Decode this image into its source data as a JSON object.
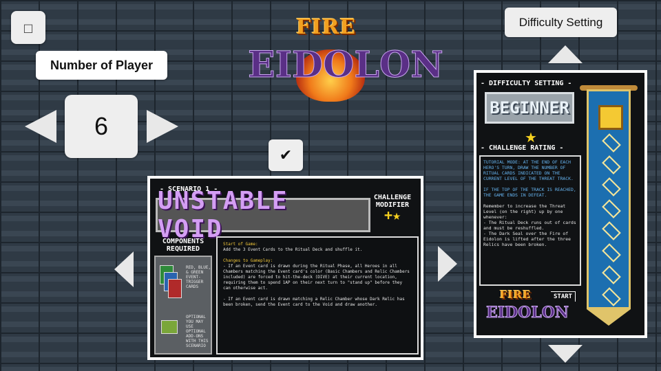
{
  "controls": {
    "menu_glyph": "□",
    "player_label": "Number of Player",
    "player_count": "6",
    "confirm_glyph": "✔",
    "difficulty_button": "Difficulty Setting"
  },
  "logo": {
    "line1": "FIRE",
    "line2": "EIDOLON"
  },
  "scenario": {
    "number_label": "- SCENARIO 1 -",
    "title": "UNSTABLE VOID",
    "challenge_modifier": "CHALLENGE MODIFIER",
    "modifier_value": "+★",
    "components_label": "COMPONENTS REQUIRED",
    "component1": "RED, BLUE, & GREEN EVENT-TRIGGER CARDS",
    "component2": "OPTIONAL YOU MAY USE OPTIONAL ADD-ONS WITH THIS SCENARIO",
    "start_heading": "Start of Game:",
    "start_text": "Add the 3 Event Cards to the Ritual Deck and shuffle it.",
    "changes_heading": "Changes to Gameplay:",
    "rule1": "- If an Event card is drawn during the Ritual Phase, all Heroes in all Chambers matching the Event card's color (Basic Chambers and Relic Chambers included) are forced to hit-the-deck (DIVE) at their current location, requiring them to spend 1AP on their next turn to \"stand up\" before they can otherwise act.",
    "rule2": "- If an Event card is drawn matching a Relic Chamber whose Dark Relic has been broken, send the Event card to the Void and draw another."
  },
  "difficulty": {
    "heading": "- DIFFICULTY SETTING -",
    "level": "BEGINNER",
    "star": "★",
    "rating_heading": "- CHALLENGE RATING -",
    "tutorial": "TUTORIAL MODE: AT THE END OF EACH HERO'S TURN, DRAW THE NUMBER OF RITUAL CARDS INDICATED ON THE CURRENT LEVEL OF THE THREAT TRACK.",
    "defeat": "IF THE TOP OF THE TRACK IS REACHED, THE GAME ENDS IN DEFEAT.",
    "remember": "Remember to increase the Threat Level (on the right) up by one whenever:",
    "cond1": "- The Ritual Deck runs out of cards and must be reshuffled.",
    "cond2": "- The Dark Seal over the Fire of Eidolon is lifted after the three Relics have been broken.",
    "start_label": "START"
  }
}
